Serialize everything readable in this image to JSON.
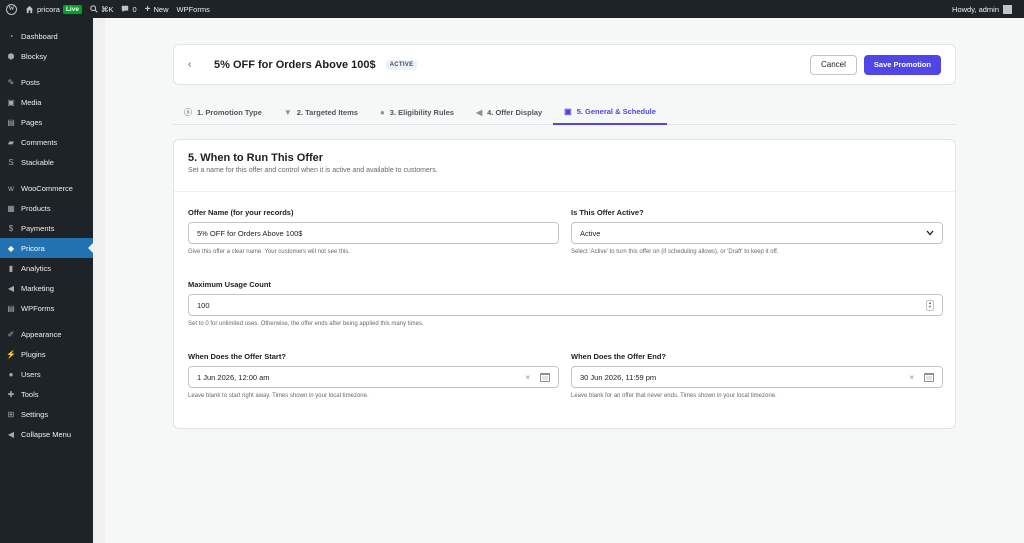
{
  "adminbar": {
    "site_name": "pricora",
    "live_badge": "Live",
    "shortcut": "⌘K",
    "comments_count": "0",
    "new_label": "New",
    "wpforms_label": "WPForms",
    "greeting": "Howdy, admin"
  },
  "sidebar": {
    "items": [
      {
        "label": "Dashboard",
        "icon": "dashboard-icon"
      },
      {
        "label": "Blocksy",
        "icon": "blocksy-icon"
      },
      {
        "label": "Posts",
        "icon": "pin-icon"
      },
      {
        "label": "Media",
        "icon": "media-icon"
      },
      {
        "label": "Pages",
        "icon": "pages-icon"
      },
      {
        "label": "Comments",
        "icon": "comments-icon"
      },
      {
        "label": "Stackable",
        "icon": "stackable-icon"
      },
      {
        "label": "WooCommerce",
        "icon": "woocommerce-icon"
      },
      {
        "label": "Products",
        "icon": "products-icon"
      },
      {
        "label": "Payments",
        "icon": "payments-icon"
      },
      {
        "label": "Pricora",
        "icon": "pricora-icon"
      },
      {
        "label": "Analytics",
        "icon": "analytics-icon"
      },
      {
        "label": "Marketing",
        "icon": "marketing-icon"
      },
      {
        "label": "WPForms",
        "icon": "wpforms-icon"
      },
      {
        "label": "Appearance",
        "icon": "appearance-icon"
      },
      {
        "label": "Plugins",
        "icon": "plugins-icon"
      },
      {
        "label": "Users",
        "icon": "users-icon"
      },
      {
        "label": "Tools",
        "icon": "tools-icon"
      },
      {
        "label": "Settings",
        "icon": "settings-icon"
      },
      {
        "label": "Collapse Menu",
        "icon": "collapse-icon"
      }
    ],
    "active_index": 10
  },
  "header": {
    "title": "5% OFF for Orders Above 100$",
    "status": "ACTIVE",
    "cancel_label": "Cancel",
    "save_label": "Save Promotion"
  },
  "tabs": [
    {
      "label": "1. Promotion Type",
      "icon": "dollar-icon"
    },
    {
      "label": "2. Targeted Items",
      "icon": "filter-icon"
    },
    {
      "label": "3. Eligibility Rules",
      "icon": "user-icon"
    },
    {
      "label": "4. Offer Display",
      "icon": "megaphone-icon"
    },
    {
      "label": "5. General & Schedule",
      "icon": "calendar-icon"
    }
  ],
  "active_tab": 4,
  "section": {
    "title": "5. When to Run This Offer",
    "description": "Set a name for this offer and control when it is active and available to customers."
  },
  "fields": {
    "offer_name": {
      "label": "Offer Name (for your records)",
      "value": "5% OFF for Orders Above 100$",
      "help": "Give this offer a clear name. Your customers will not see this."
    },
    "active": {
      "label": "Is This Offer Active?",
      "value": "Active",
      "help": "Select 'Active' to turn this offer on (if scheduling allows), or 'Draft' to keep it off."
    },
    "max_usage": {
      "label": "Maximum Usage Count",
      "value": "100",
      "help": "Set to 0 for unlimited uses. Otherwise, the offer ends after being applied this many times."
    },
    "start": {
      "label": "When Does the Offer Start?",
      "value": "1 Jun 2026, 12:00 am",
      "help": "Leave blank to start right away. Times shown in your local timezone."
    },
    "end": {
      "label": "When Does the Offer End?",
      "value": "30 Jun 2026, 11:59 pm",
      "help": "Leave blank for an offer that never ends. Times shown in your local timezone."
    }
  },
  "colors": {
    "accent": "#4f46e5",
    "admin_bar": "#1d2327",
    "sidebar_active": "#2271b1",
    "live_badge": "#00a32a"
  }
}
